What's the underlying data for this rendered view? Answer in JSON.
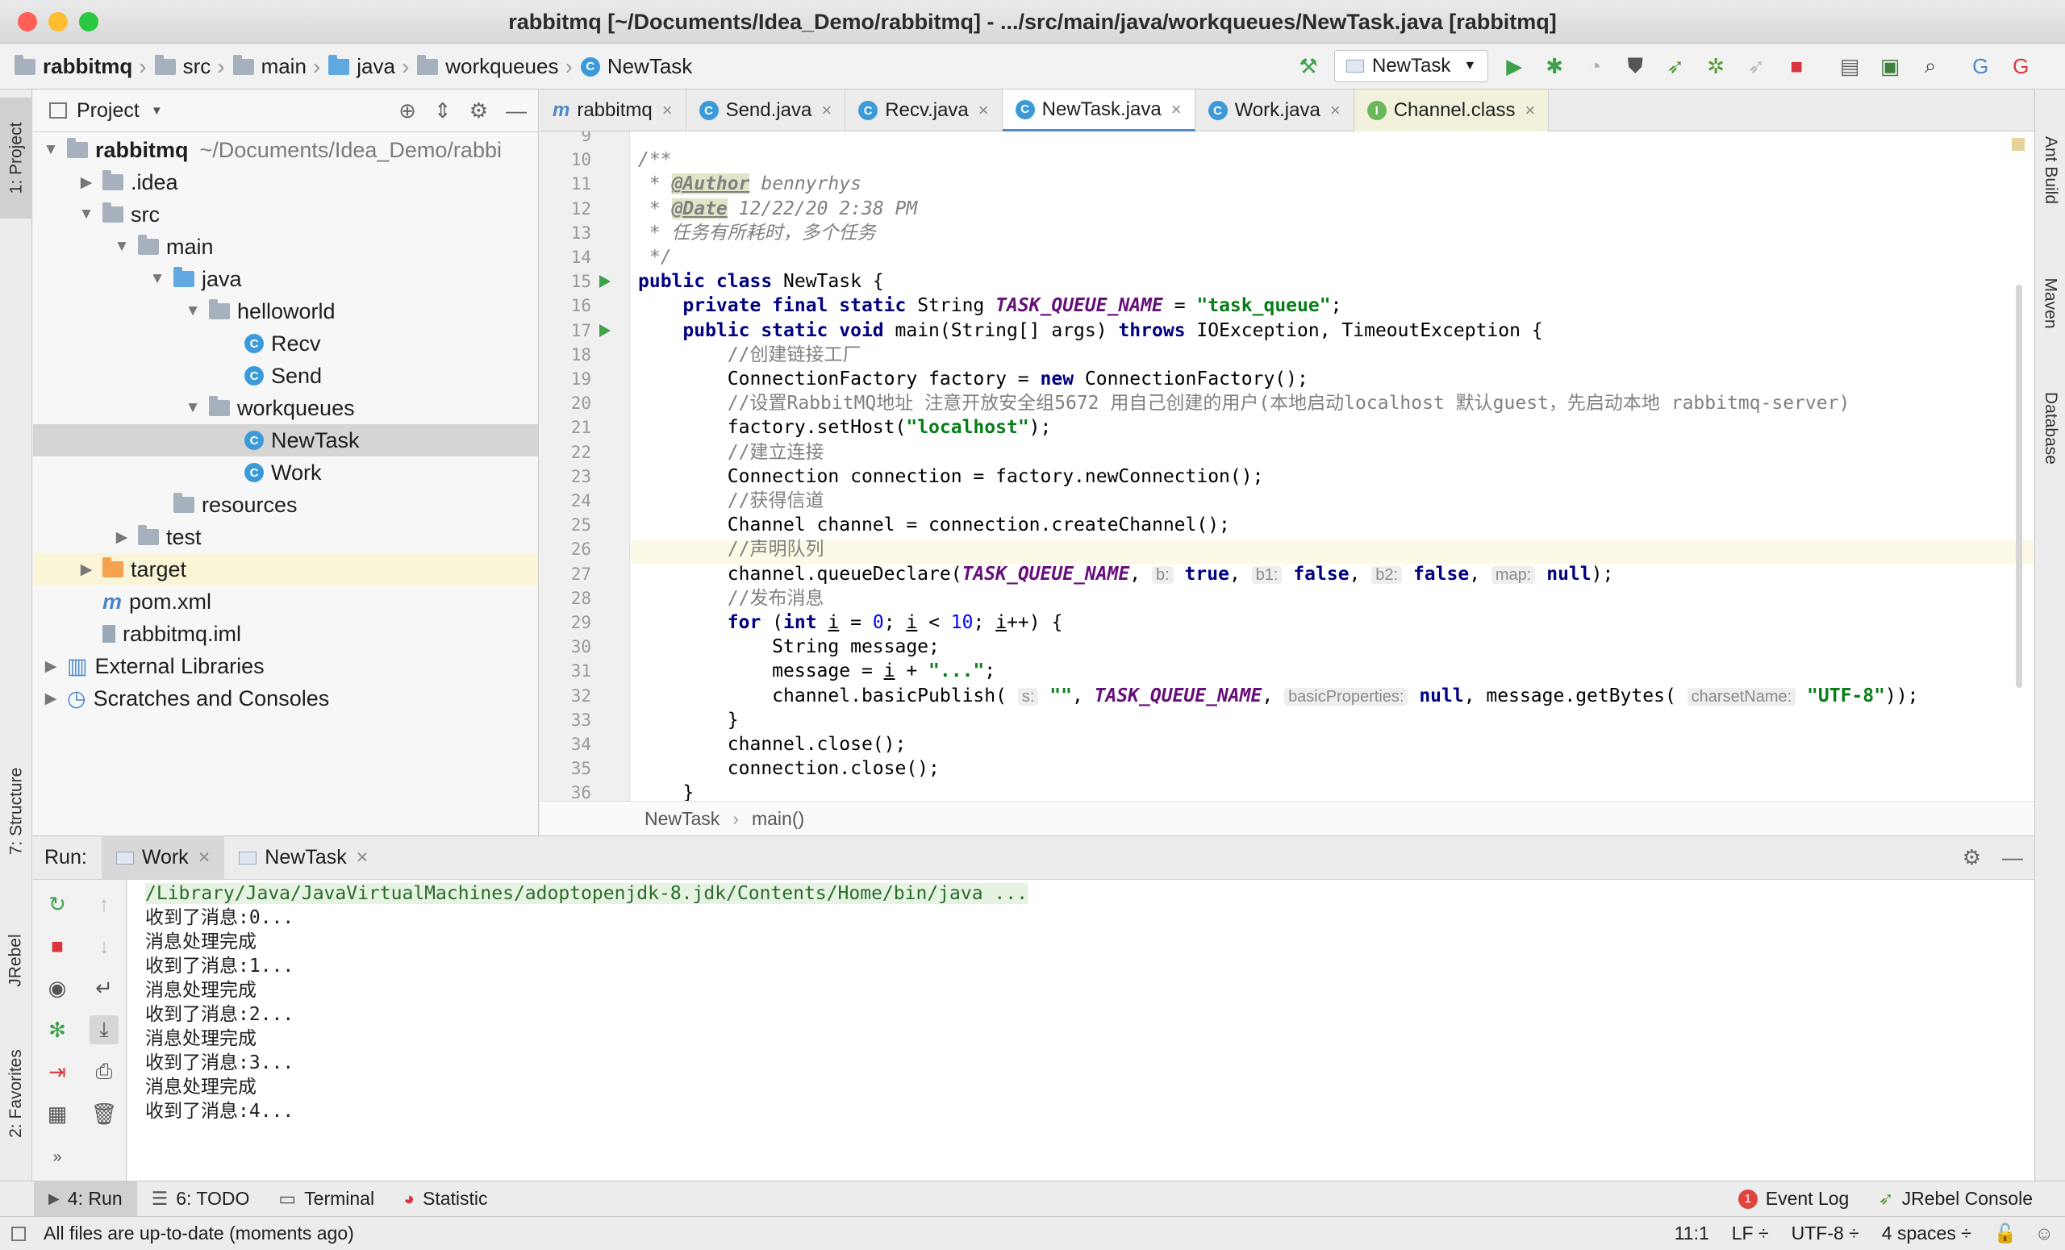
{
  "window": {
    "title": "rabbitmq [~/Documents/Idea_Demo/rabbitmq] - .../src/main/java/workqueues/NewTask.java [rabbitmq]",
    "colors": {
      "close": "#ff5f57",
      "minimize": "#febc2e",
      "zoom": "#28c840",
      "accent": "#4a88c7"
    }
  },
  "breadcrumb": [
    "rabbitmq",
    "src",
    "main",
    "java",
    "workqueues",
    "NewTask"
  ],
  "run_config": "NewTask",
  "project_panel": {
    "title": "Project",
    "tree": [
      {
        "label": "rabbitmq",
        "extra": "~/Documents/Idea_Demo/rabbi",
        "depth": 0,
        "arrow": "▼",
        "icon": "module-folder-icon"
      },
      {
        "label": ".idea",
        "depth": 1,
        "arrow": "▶",
        "icon": "folder-icon"
      },
      {
        "label": "src",
        "depth": 1,
        "arrow": "▼",
        "icon": "folder-icon"
      },
      {
        "label": "main",
        "depth": 2,
        "arrow": "▼",
        "icon": "folder-icon"
      },
      {
        "label": "java",
        "depth": 3,
        "arrow": "▼",
        "icon": "source-folder-icon"
      },
      {
        "label": "helloworld",
        "depth": 4,
        "arrow": "▼",
        "icon": "package-icon"
      },
      {
        "label": "Recv",
        "depth": 5,
        "arrow": "",
        "icon": "class-icon"
      },
      {
        "label": "Send",
        "depth": 5,
        "arrow": "",
        "icon": "class-icon"
      },
      {
        "label": "workqueues",
        "depth": 4,
        "arrow": "▼",
        "icon": "package-icon"
      },
      {
        "label": "NewTask",
        "depth": 5,
        "arrow": "",
        "icon": "class-icon"
      },
      {
        "label": "Work",
        "depth": 5,
        "arrow": "",
        "icon": "class-icon"
      },
      {
        "label": "resources",
        "depth": 3,
        "arrow": "",
        "icon": "resources-folder-icon"
      },
      {
        "label": "test",
        "depth": 2,
        "arrow": "▶",
        "icon": "folder-icon"
      },
      {
        "label": "target",
        "depth": 1,
        "arrow": "▶",
        "icon": "excluded-folder-icon"
      },
      {
        "label": "pom.xml",
        "depth": 1,
        "arrow": "",
        "icon": "maven-icon"
      },
      {
        "label": "rabbitmq.iml",
        "depth": 1,
        "arrow": "",
        "icon": "iml-file-icon"
      },
      {
        "label": "External Libraries",
        "depth": 0,
        "arrow": "▶",
        "icon": "libraries-icon"
      },
      {
        "label": "Scratches and Consoles",
        "depth": 0,
        "arrow": "▶",
        "icon": "scratches-icon"
      }
    ]
  },
  "editor_tabs": [
    {
      "label": "rabbitmq",
      "icon": "maven-icon"
    },
    {
      "label": "Send.java",
      "icon": "class-icon"
    },
    {
      "label": "Recv.java",
      "icon": "class-icon"
    },
    {
      "label": "NewTask.java",
      "icon": "class-icon",
      "active": true
    },
    {
      "label": "Work.java",
      "icon": "class-icon"
    },
    {
      "label": "Channel.class",
      "icon": "interface-icon"
    }
  ],
  "code_line_numbers": [
    "9",
    "10",
    "11",
    "12",
    "13",
    "14",
    "15",
    "16",
    "17",
    "18",
    "19",
    "20",
    "21",
    "22",
    "23",
    "24",
    "25",
    "26",
    "27",
    "28",
    "29",
    "30",
    "31",
    "32",
    "33",
    "34",
    "35",
    "36"
  ],
  "code": {
    "l10": "/**",
    "l11_tag": "@Author",
    "l11_val": "bennyrhys",
    "l12_tag": "@Date",
    "l12_val": "12/22/20 2:38 PM",
    "l13": " * 任务有所耗时，多个任务",
    "l14": " */",
    "cls_name": "NewTask",
    "queue_const": "TASK_QUEUE_NAME",
    "queue_name": "\"task_queue\"",
    "c18": "//创建链接工厂",
    "c20": "//设置RabbitMQ地址 注意开放安全组5672 用自己创建的用户(本地启动localhost 默认guest，先启动本地 rabbitmq-server)",
    "host": "\"localhost\"",
    "c22": "//建立连接",
    "c24": "//获得信道",
    "c26": "//声明队列",
    "hint_b": "b:",
    "hint_b1": "b1:",
    "hint_b2": "b2:",
    "hint_map": "map:",
    "c28": "//发布消息",
    "loop_max": "10",
    "dots": "\"...\"",
    "empty_str": "\"\"",
    "hint_s": "s:",
    "hint_props": "basicProperties:",
    "hint_charset": "charsetName:",
    "charset": "\"UTF-8\""
  },
  "editor_crumb": [
    "NewTask",
    "main()"
  ],
  "run_panel": {
    "label": "Run:",
    "tabs": [
      "Work",
      "NewTask"
    ],
    "console": [
      "/Library/Java/JavaVirtualMachines/adoptopenjdk-8.jdk/Contents/Home/bin/java ...",
      "收到了消息:0...",
      "消息处理完成",
      "收到了消息:1...",
      "消息处理完成",
      "收到了消息:2...",
      "消息处理完成",
      "收到了消息:3...",
      "消息处理完成",
      "收到了消息:4..."
    ]
  },
  "side_tabs": {
    "left": [
      "1: Project",
      "7: Structure",
      "JRebel",
      "2: Favorites"
    ],
    "right": [
      "Ant Build",
      "Maven",
      "Database"
    ]
  },
  "bottom_tabs": [
    "4: Run",
    "6: TODO",
    "Terminal",
    "Statistic"
  ],
  "bottom_right": {
    "event_log": "Event Log",
    "event_count": "1",
    "jrebel": "JRebel Console"
  },
  "status": {
    "message": "All files are up-to-date (moments ago)",
    "position": "11:1",
    "line_sep": "LF ÷",
    "encoding": "UTF-8 ÷",
    "indent": "4 spaces ÷"
  }
}
